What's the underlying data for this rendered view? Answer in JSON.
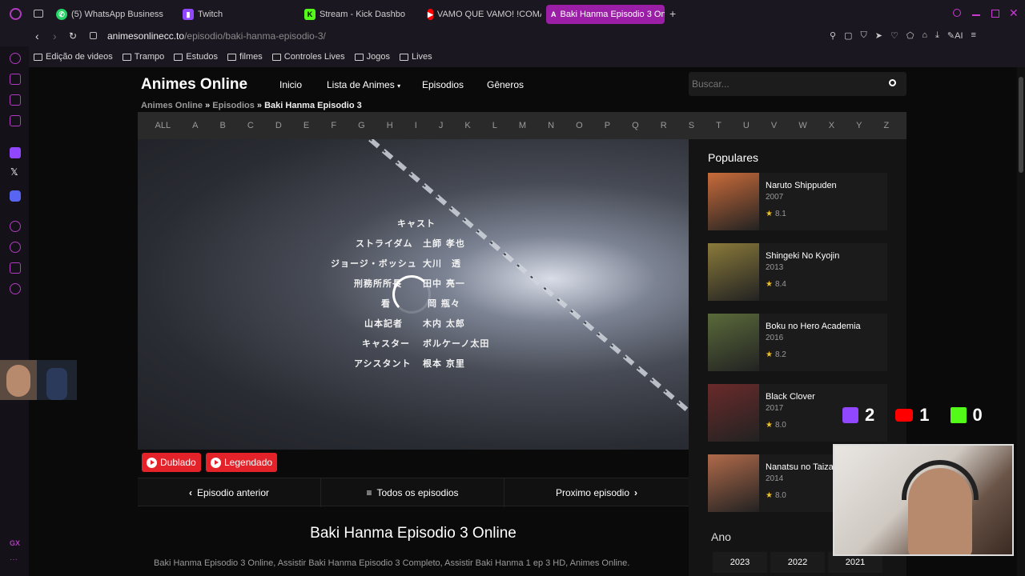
{
  "tabs": [
    {
      "label": "(5) WhatsApp Business",
      "icon": "whatsapp-icon"
    },
    {
      "label": "Twitch",
      "icon": "twitch-icon"
    },
    {
      "label": "Stream - Kick Dashbo",
      "icon": "kick-icon"
    },
    {
      "label": "VAMO QUE VAMO! !COMA",
      "icon": "youtube-icon"
    },
    {
      "label": "Baki Hanma Episodio 3 On",
      "icon": "animes-icon",
      "active": true
    }
  ],
  "address": {
    "domain": "animesonlinecc.to",
    "path": "/episodio/baki-hanma-episodio-3/"
  },
  "bookmarks": [
    "Edição de videos",
    "Trampo",
    "Estudos",
    "filmes",
    "Controles Lives",
    "Jogos",
    "Lives"
  ],
  "site": {
    "logo": "Animes Online",
    "nav": [
      "Inicio",
      "Lista de Animes",
      "Episodios",
      "Gêneros"
    ],
    "search_placeholder": "Buscar..."
  },
  "breadcrumb": {
    "home": "Animes Online",
    "section": "Episodios",
    "current": "Baki Hanma Episodio 3"
  },
  "alphabet": [
    "ALL",
    "A",
    "B",
    "C",
    "D",
    "E",
    "F",
    "G",
    "H",
    "I",
    "J",
    "K",
    "L",
    "M",
    "N",
    "O",
    "P",
    "Q",
    "R",
    "S",
    "T",
    "U",
    "V",
    "W",
    "X",
    "Y",
    "Z"
  ],
  "video_credits": [
    {
      "role": "キャスト",
      "name": ""
    },
    {
      "role": "ストライダム",
      "name": "土師 孝也"
    },
    {
      "role": "ジョージ・ボッシュ",
      "name": "大川　透"
    },
    {
      "role": "刑務所所長",
      "name": "田中 亮一"
    },
    {
      "role": "看",
      "name": "岡 瓶々"
    },
    {
      "role": "山本記者",
      "name": "木内 太郎"
    },
    {
      "role": "キャスター",
      "name": "ボルケーノ太田"
    },
    {
      "role": "アシスタント",
      "name": "根本 京里"
    }
  ],
  "audio_buttons": {
    "dub": "Dublado",
    "sub": "Legendado"
  },
  "episode_nav": {
    "prev": "Episodio anterior",
    "all": "Todos os episodios",
    "next": "Proximo episodio"
  },
  "page_title": "Baki Hanma Episodio 3 Online",
  "description": "Baki Hanma Episodio 3 Online, Assistir Baki Hanma Episodio 3 Completo, Assistir Baki Hanma 1 ep 3 HD, Animes Online.",
  "sidebar": {
    "popular_title": "Populares",
    "items": [
      {
        "title": "Naruto Shippuden",
        "year": "2007",
        "rating": "8.1",
        "color": "#c96b3a"
      },
      {
        "title": "Shingeki No Kyojin",
        "year": "2013",
        "rating": "8.4",
        "color": "#8a7a3a"
      },
      {
        "title": "Boku no Hero Academia",
        "year": "2016",
        "rating": "8.2",
        "color": "#5a6a3a"
      },
      {
        "title": "Black Clover",
        "year": "2017",
        "rating": "8.0",
        "color": "#6a2a2a"
      },
      {
        "title": "Nanatsu no Taizai",
        "year": "2014",
        "rating": "8.0",
        "color": "#b06a4a"
      }
    ],
    "year_title": "Ano",
    "years": [
      "2023",
      "2022",
      "2021"
    ]
  },
  "stream_counters": {
    "twitch": "2",
    "youtube": "1",
    "kick": "0"
  }
}
